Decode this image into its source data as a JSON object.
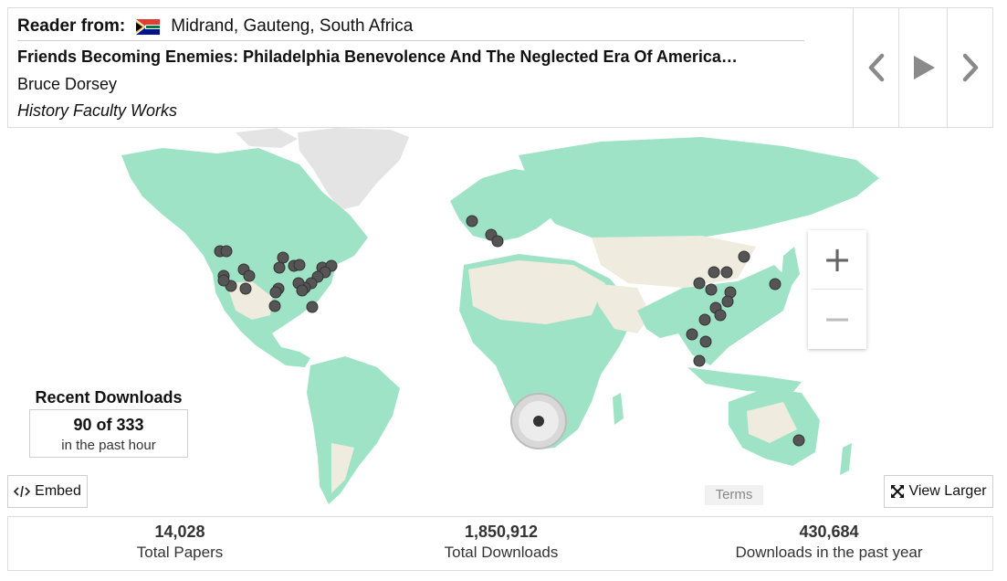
{
  "reader": {
    "label": "Reader from:",
    "location": "Midrand, Gauteng, South Africa",
    "flag_icon": "south-africa-flag-icon"
  },
  "paper": {
    "title": "Friends Becoming Enemies: Philadelphia Benevolence And The Neglected Era Of America…",
    "author": "Bruce Dorsey",
    "collection": "History Faculty Works"
  },
  "nav": {
    "prev_icon": "chevron-left-icon",
    "play_icon": "play-icon",
    "next_icon": "chevron-right-icon"
  },
  "map": {
    "zoom_in": "+",
    "zoom_out": "−",
    "terms": "Terms",
    "land_color": "#9fe3c6",
    "desert_color": "#f0ebdf",
    "ice_color": "#e4e4e4",
    "marker_color": "#555555"
  },
  "recent": {
    "title": "Recent Downloads",
    "count": "90 of 333",
    "period": "in the past hour"
  },
  "buttons": {
    "embed_label": "Embed",
    "view_larger_label": "View Larger"
  },
  "stats": [
    {
      "value": "14,028",
      "label": "Total Papers"
    },
    {
      "value": "1,850,912",
      "label": "Total Downloads"
    },
    {
      "value": "430,684",
      "label": "Downloads in the past year"
    }
  ]
}
